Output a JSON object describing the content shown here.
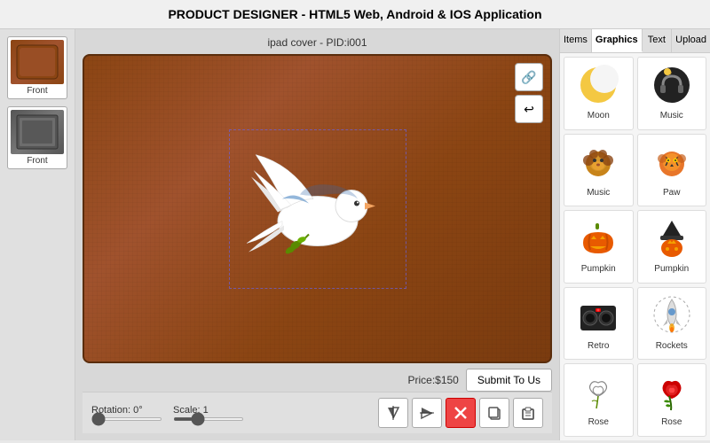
{
  "header": {
    "title": "PRODUCT DESIGNER - HTML5 Web, Android & IOS Application"
  },
  "left_panel": {
    "thumbnails": [
      {
        "id": "thumb-1",
        "label": "Front",
        "type": "brown"
      },
      {
        "id": "thumb-2",
        "label": "Front",
        "type": "gray"
      }
    ]
  },
  "canvas": {
    "product_title": "ipad cover - PID:i001",
    "price_label": "Price:$150",
    "submit_label": "Submit To Us",
    "buttons": {
      "link": "🔗",
      "undo": "↩"
    }
  },
  "toolbar": {
    "rotation_label": "Rotation: 0°",
    "scale_label": "Scale: 1",
    "tools": [
      {
        "id": "flip-h",
        "icon": "⊳|",
        "label": "Flip Horizontal"
      },
      {
        "id": "flip-v",
        "icon": "|⊳",
        "label": "Flip Vertical"
      },
      {
        "id": "delete",
        "icon": "✕",
        "label": "Delete",
        "red": true
      },
      {
        "id": "copy",
        "icon": "❐",
        "label": "Copy"
      },
      {
        "id": "paste",
        "icon": "⧉",
        "label": "Paste"
      }
    ]
  },
  "right_panel": {
    "tabs": [
      {
        "id": "items",
        "label": "Items",
        "active": false
      },
      {
        "id": "graphics",
        "label": "Graphics",
        "active": true
      },
      {
        "id": "text",
        "label": "Text",
        "active": false
      },
      {
        "id": "upload",
        "label": "Upload",
        "active": false
      }
    ],
    "graphics": [
      {
        "id": "moon",
        "label": "Moon",
        "emoji": "🌙"
      },
      {
        "id": "music1",
        "label": "Music",
        "emoji": "🎵"
      },
      {
        "id": "music2",
        "label": "Music",
        "emoji": "🦁"
      },
      {
        "id": "paw",
        "label": "Paw",
        "emoji": "🐯"
      },
      {
        "id": "pumpkin1",
        "label": "Pumpkin",
        "emoji": "🎃"
      },
      {
        "id": "pumpkin2",
        "label": "Pumpkin",
        "emoji": "🧙"
      },
      {
        "id": "retro",
        "label": "Retro",
        "emoji": "🎸"
      },
      {
        "id": "rockets",
        "label": "Rockets",
        "emoji": "🚀"
      },
      {
        "id": "rose1",
        "label": "Rose",
        "emoji": "🌹"
      },
      {
        "id": "rose2",
        "label": "Rose",
        "emoji": "🌺"
      }
    ]
  }
}
